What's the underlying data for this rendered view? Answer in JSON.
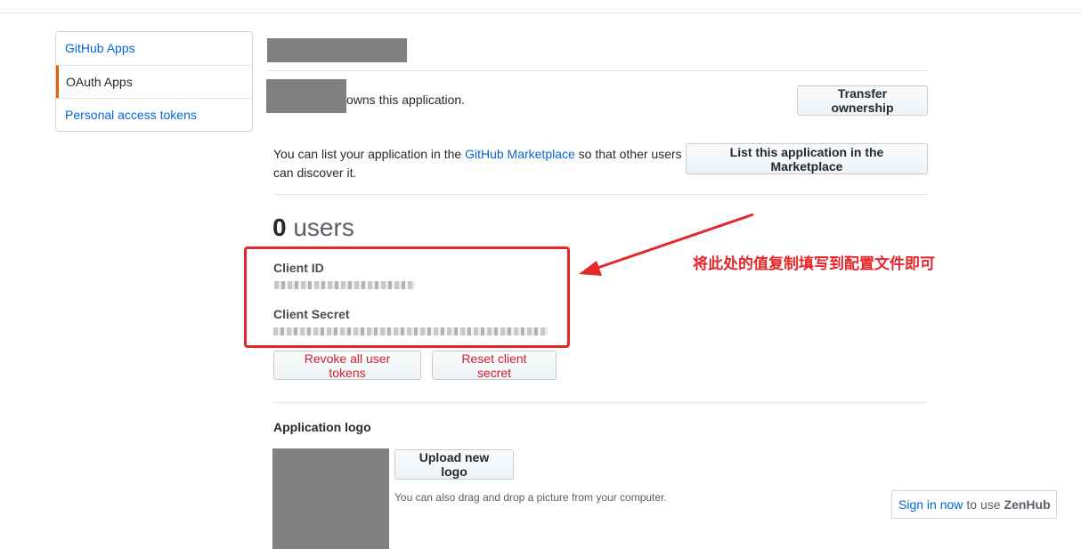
{
  "sidebar": {
    "items": [
      {
        "label": "GitHub Apps"
      },
      {
        "label": "OAuth Apps"
      },
      {
        "label": "Personal access tokens"
      }
    ]
  },
  "owner": {
    "suffix": "owns this application.",
    "transfer_button": "Transfer ownership"
  },
  "marketplace": {
    "text_before": "You can list your application in the ",
    "link": "GitHub Marketplace",
    "text_after": " so that other users",
    "text_line2": "can discover it.",
    "list_button": "List this application in the Marketplace"
  },
  "users": {
    "count": "0",
    "label": "users"
  },
  "credentials": {
    "client_id_label": "Client ID",
    "client_secret_label": "Client Secret"
  },
  "actions": {
    "revoke_button": "Revoke all user tokens",
    "reset_button": "Reset client secret"
  },
  "logo": {
    "heading": "Application logo",
    "upload_button": "Upload new logo",
    "hint": "You can also drag and drop a picture from your computer."
  },
  "annotation": {
    "text": "将此处的值复制填写到配置文件即可",
    "color": "#e5262a"
  },
  "zenhub": {
    "link": "Sign in now",
    "middle": "to use",
    "brand": "ZenHub"
  },
  "colors": {
    "link": "#0366d6",
    "danger": "#cb2431",
    "selected_border": "#e36209",
    "redaction": "#808080"
  }
}
